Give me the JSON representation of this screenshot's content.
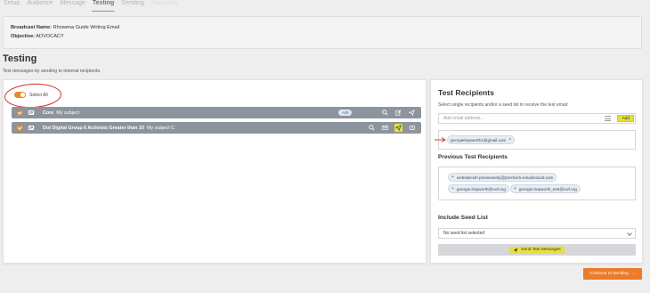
{
  "tabs": [
    "Setup",
    "Audience",
    "Message",
    "Testing",
    "Sending",
    "Reporting"
  ],
  "broadcast": {
    "name_label": "Broadcast Name:",
    "name_value": "Rhowena Guide Writing Email",
    "objective_label": "Objective:",
    "objective_value": "ADVOCACY"
  },
  "page": {
    "title": "Testing",
    "subtitle": "Test messages by sending to internal recipients."
  },
  "select_all_label": "Select All",
  "messages": [
    {
      "name": "Core",
      "subject": "My subject",
      "badge": "A/B"
    },
    {
      "name": "Dot Digital Group 6 Activists Greater than 10",
      "subject": "My subject C",
      "badge": ""
    }
  ],
  "test_recipients": {
    "title": "Test Recipients",
    "description": "Select single recipients and/or a seed list to receive the test email:",
    "input_placeholder": "Add email address...",
    "add_label": "Add",
    "selected": [
      "georgiehepworth1@gmail.com"
    ]
  },
  "previous": {
    "title": "Previous Test Recipients",
    "items": [
      "websitecwf+previewonly@precheck.emailonacid.com",
      "georgie.hepworth@cwf.org",
      "georgie.hepworth_test@cwf.org"
    ]
  },
  "seed": {
    "title": "Include Seed List",
    "selected": "No seed list selected"
  },
  "send_label": "Send Test Messages",
  "continue_label": "Continue to Sending",
  "colors": {
    "accent": "#ec7b2c",
    "highlight": "#e6e03a",
    "row_bg": "#8d949d",
    "annotation": "#d62828"
  }
}
